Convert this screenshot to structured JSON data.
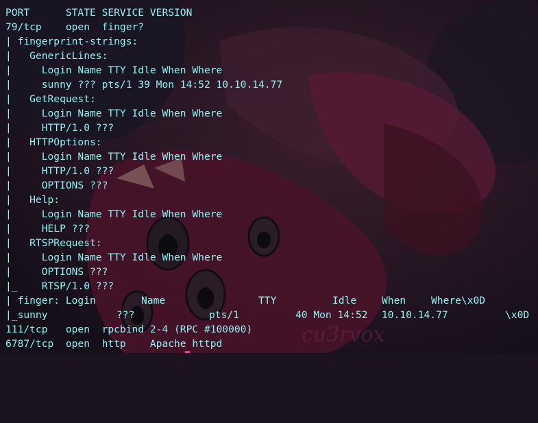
{
  "terminal": {
    "lines": [
      "PORT      STATE SERVICE VERSION",
      "79/tcp    open  finger?",
      "| fingerprint-strings:",
      "|   GenericLines:",
      "|     Login Name TTY Idle When Where",
      "|     sunny ??? pts/1 39 Mon 14:52 10.10.14.77",
      "|   GetRequest:",
      "|     Login Name TTY Idle When Where",
      "|     HTTP/1.0 ???",
      "|   HTTPOptions:",
      "|     Login Name TTY Idle When Where",
      "|     HTTP/1.0 ???",
      "|     OPTIONS ???",
      "|   Help:",
      "|     Login Name TTY Idle When Where",
      "|     HELP ???",
      "|   RTSPRequest:",
      "|     Login Name TTY Idle When Where",
      "|     OPTIONS ???",
      "|_    RTSP/1.0 ???"
    ],
    "finger_header": {
      "col1": "| finger: Login",
      "col2": "Name",
      "col3": "TTY",
      "col4": "Idle",
      "col5": "When",
      "col6": "Where\\x0D"
    },
    "finger_row": {
      "col1": "|_sunny",
      "col2": "???",
      "col3": "pts/1",
      "col4": "40 Mon 14:52",
      "col5": "10.10.14.77",
      "col6": "\\x0D"
    },
    "tail_lines": [
      "111/tcp   open  rpcbind 2-4 (RPC #100000)",
      "6787/tcp  open  http    Apache httpd"
    ]
  },
  "background": {
    "watermark_text": "cu3rvox",
    "colors": {
      "base": "#1b1320",
      "accent": "#5a1a34",
      "text": "#8ff3f3",
      "cursor": "#e0409a"
    }
  }
}
